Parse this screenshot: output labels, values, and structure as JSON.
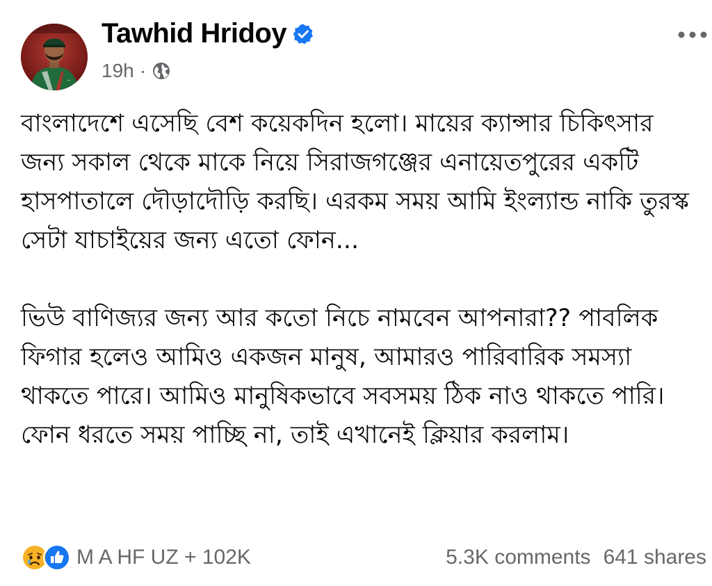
{
  "post": {
    "author": "Tawhid Hridoy",
    "time": "19h",
    "separator": "·",
    "paragraphs": [
      "বাংলাদেশে এসেছি বেশ কয়েকদিন হলো। মায়ের ক্যান্সার চিকিৎসার জন্য সকাল থেকে মাকে নিয়ে সিরাজগঞ্জের এনায়েতপুরের একটি হাসপাতালে দৌড়াদৌড়ি করছি। এরকম সময় আমি ইংল্যান্ড নাকি তুরস্ক সেটা যাচাইয়ের জন্য এতো ফোন...",
      "ভিউ বাণিজ্যর জন্য আর কতো নিচে নামবেন আপনারা?? পাবলিক ফিগার হলেও আমিও একজন মানুষ, আমারও পারিবারিক সমস্যা থাকতে পারে। আমিও মানুষিকভাবে সবসময় ঠিক নাও থাকতে পারি। ফোন ধরতে সময় পাচ্ছি না, তাই এখানেই ক্লিয়ার করলাম।"
    ],
    "reactions_summary": "M A HF UZ + 102K",
    "comments": "5.3K comments",
    "shares": "641 shares"
  },
  "icons": {
    "verified": "verified-badge-icon",
    "privacy": "globe-icon",
    "more": "more-options-icon",
    "reaction_1": "sad-reaction-icon",
    "reaction_2": "like-reaction-icon"
  },
  "colors": {
    "verified_blue": "#1877F2",
    "secondary_text": "#65676B",
    "primary_text": "#050505"
  }
}
